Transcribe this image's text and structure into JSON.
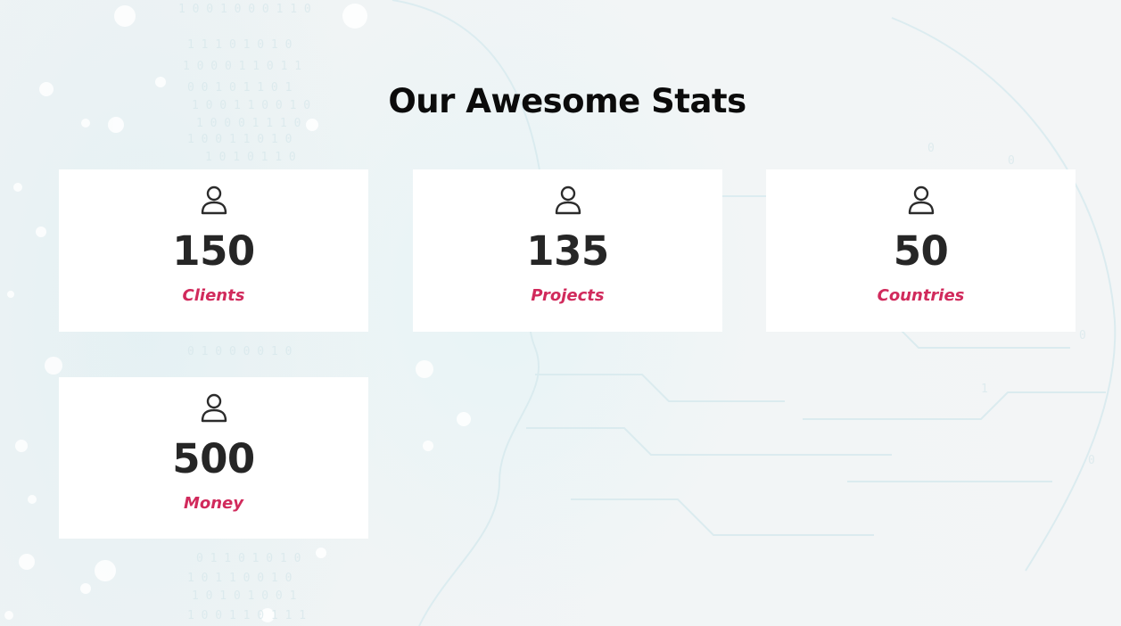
{
  "section": {
    "title": "Our Awesome Stats"
  },
  "stats": [
    {
      "value": "150",
      "label": "Clients",
      "icon": "user-icon"
    },
    {
      "value": "135",
      "label": "Projects",
      "icon": "user-icon"
    },
    {
      "value": "50",
      "label": "Countries",
      "icon": "user-icon"
    },
    {
      "value": "500",
      "label": "Money",
      "icon": "user-icon"
    }
  ],
  "colors": {
    "accent": "#d12a5c",
    "number": "#262626",
    "title": "#0b0b0b",
    "card_bg": "#ffffff",
    "page_bg": "#f1f4f5"
  }
}
